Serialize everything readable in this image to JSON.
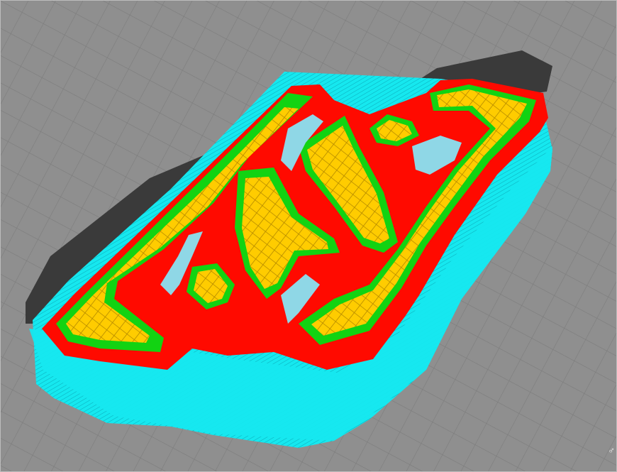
{
  "viewport": {
    "view": "layer-preview-3d",
    "background_color": "#8f8f8f",
    "grid_color": "#7c7c7c",
    "shadow_color": "#3a3a3a"
  },
  "print_preview": {
    "feature_colors": {
      "support": "#16e8ef",
      "support_dark": "#0fb7c4",
      "outer_wall": "#ff0a00",
      "inner_wall": "#12d312",
      "infill": "#ffcc00",
      "infill_lines": "#b38900"
    }
  },
  "axis_indicator": {
    "icon": "orientation-gizmo-icon",
    "glyph": "♂"
  }
}
